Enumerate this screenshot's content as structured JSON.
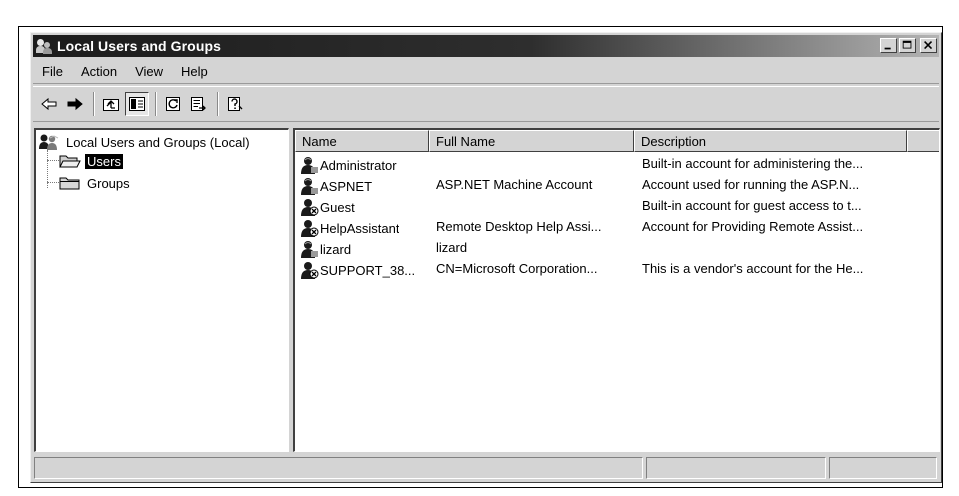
{
  "window": {
    "title": "Local Users and Groups",
    "title_icon": "users-icon",
    "buttons": [
      "minimize-icon",
      "maximize-icon",
      "close-icon"
    ]
  },
  "menubar": {
    "items": [
      "File",
      "Action",
      "View",
      "Help"
    ]
  },
  "toolbar": {
    "buttons": [
      "back-arrow-icon",
      "forward-arrow-icon",
      "up-folder-icon",
      "show-hide-tree-icon",
      "refresh-icon",
      "export-list-icon",
      "help-icon"
    ]
  },
  "tree": {
    "root_label": "Local Users and Groups (Local)",
    "nodes": [
      {
        "label": "Users",
        "selected": true
      },
      {
        "label": "Groups",
        "selected": false
      }
    ]
  },
  "list": {
    "columns": [
      "Name",
      "Full Name",
      "Description"
    ],
    "rows": [
      {
        "name": "Administrator",
        "full_name": "",
        "description": "Built-in account for administering the..."
      },
      {
        "name": "ASPNET",
        "full_name": "ASP.NET Machine Account",
        "description": "Account used for running the ASP.N..."
      },
      {
        "name": "Guest",
        "full_name": "",
        "description": "Built-in account for guest access to t..."
      },
      {
        "name": "HelpAssistant",
        "full_name": "Remote Desktop Help Assi...",
        "description": "Account for Providing Remote Assist..."
      },
      {
        "name": "lizard",
        "full_name": "lizard",
        "description": ""
      },
      {
        "name": "SUPPORT_38...",
        "full_name": "CN=Microsoft Corporation...",
        "description": "This is a vendor's account for the He..."
      }
    ]
  },
  "statusbar": {
    "cells": [
      "",
      "",
      ""
    ]
  }
}
